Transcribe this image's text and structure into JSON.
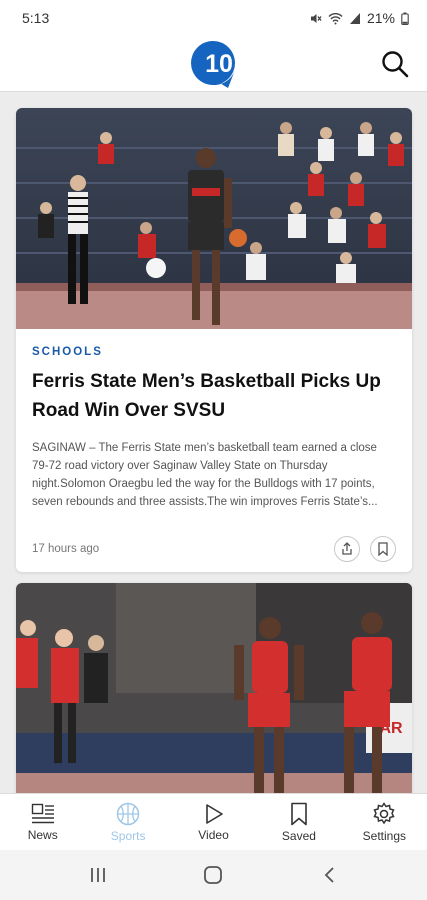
{
  "status_bar": {
    "time": "5:13",
    "battery": "21%",
    "icons": [
      "mute-icon",
      "wifi-icon",
      "signal-icon",
      "battery-icon"
    ]
  },
  "header": {
    "logo_text": "10",
    "logo_color": "#1565c0",
    "search_icon": "search-icon"
  },
  "feed": {
    "articles": [
      {
        "category": "SCHOOLS",
        "headline": "Ferris State Men’s Basketball Picks Up Road Win Over SVSU",
        "summary": "SAGINAW – The Ferris State men’s basketball team earned a close 79-72 road victory over Saginaw Valley State on Thursday night.Solomon Oraegbu led the way for the Bulldogs with 17 points, seven rebounds and three assists.The win improves Ferris State’s...",
        "timestamp": "17 hours ago",
        "image": "basketball-player-dribbling-photo"
      },
      {
        "image": "womens-basketball-players-photo"
      }
    ]
  },
  "bottom_nav": {
    "items": [
      {
        "label": "News",
        "icon": "news-icon"
      },
      {
        "label": "Sports",
        "icon": "basketball-icon",
        "active": true
      },
      {
        "label": "Video",
        "icon": "play-icon"
      },
      {
        "label": "Saved",
        "icon": "bookmark-icon"
      },
      {
        "label": "Settings",
        "icon": "gear-icon"
      }
    ]
  },
  "colors": {
    "accent": "#1a5aa8",
    "active_tab": "#9ec6e6"
  }
}
